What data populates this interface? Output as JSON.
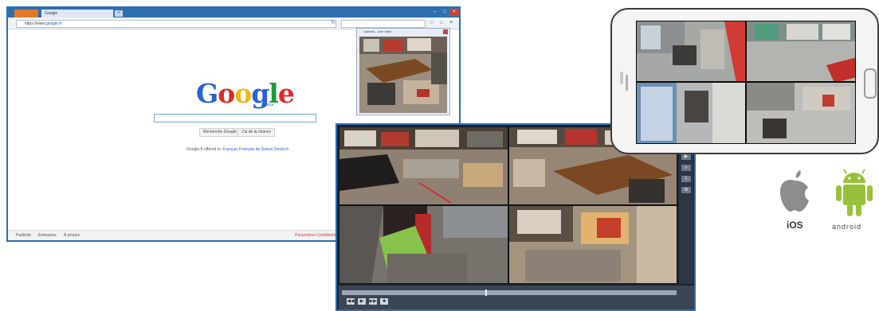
{
  "browser": {
    "tab_label": "Google",
    "tab2_label": "Google",
    "new_tab_symbol": "+",
    "window_controls": [
      "–",
      "□",
      "×"
    ],
    "url_prefix": "https://www.",
    "url_domain": "google.fr",
    "logo": "Google",
    "logo_sub": "France",
    "buttons": [
      "Recherche Google",
      "J'ai de la chance"
    ],
    "offered_prefix": "Google.fr offered in:",
    "offered_links": "Français  Français de Suisse  Deutsch",
    "footer_left": [
      "Publicité",
      "Entreprise",
      "À propos"
    ],
    "footer_right": "Paramètres  Confidentialité",
    "popup_title": "Camera - Live View"
  },
  "vms": {
    "transport": [
      "◀◀",
      "▶",
      "▶▶",
      "■"
    ]
  },
  "os_logos": {
    "ios_label": "iOS",
    "android_label": "android"
  },
  "colors": {
    "window_blue": "#2f6fb0",
    "floor_red": "#b8322e",
    "apple_grey": "#8d8d8d",
    "android_green": "#97c13b"
  }
}
